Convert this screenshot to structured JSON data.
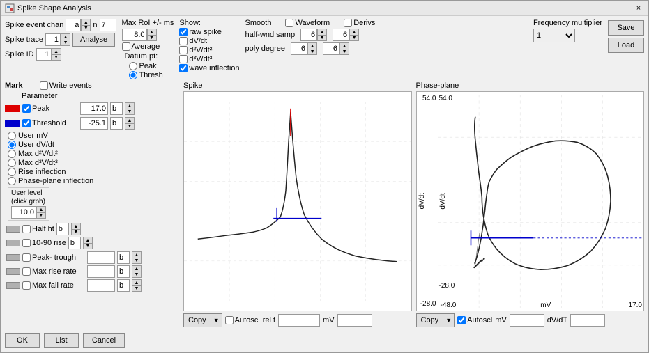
{
  "window": {
    "title": "Spike Shape Analysis",
    "close_label": "×"
  },
  "top": {
    "spike_event_label": "Spike event chan",
    "spike_event_val": "a",
    "n_label": "n",
    "n_val": "7",
    "max_roi_label": "Max RoI +/- ms",
    "max_roi_val": "8.0",
    "show_label": "Show:",
    "raw_spike_label": "raw spike",
    "dv_dt_label": "dV/dt",
    "d2v_dt2_label": "d²V/dt²",
    "d3v_dt3_label": "d³V/dt³",
    "wave_inflection_label": "wave inflection",
    "average_label": "Average",
    "datum_label": "Datum pt:",
    "peak_label": "Peak",
    "thresh_label": "Thresh",
    "smooth_label": "Smooth",
    "waveform_label": "Waveform",
    "derivs_label": "Derivs",
    "half_wnd_samp_label": "half-wnd samp",
    "poly_degree_label": "poly degree",
    "smooth_w1": "6",
    "smooth_w2": "6",
    "smooth_p1": "6",
    "smooth_p2": "6",
    "freq_mult_label": "Frequency multiplier",
    "freq_mult_val": "1",
    "save_label": "Save",
    "load_label": "Load"
  },
  "spike_trace": {
    "label": "Spike trace",
    "val": "1"
  },
  "spike_id": {
    "label": "Spike ID",
    "val": "1"
  },
  "analyse_label": "Analyse",
  "mark": {
    "label": "Mark",
    "write_events_label": "Write events",
    "parameter_label": "Parameter",
    "peak_label": "Peak",
    "peak_val": "17.0",
    "threshold_label": "Threshold",
    "threshold_val": "-25.1",
    "b_label": "b",
    "user_mv_label": "User mV",
    "user_dv_dt_label": "User dV/dt",
    "max_d2v_label": "Max d²V/dt²",
    "max_d3v_label": "Max d³V/dt³",
    "rise_inflection_label": "Rise inflection",
    "phase_plane_label": "Phase-plane inflection",
    "user_level_label": "User level\n(click grph)",
    "user_level_val": "10.0",
    "half_ht_label": "Half ht",
    "ten_90_rise_label": "10-90 rise",
    "peak_trough_label": "Peak- trough",
    "max_rise_rate_label": "Max rise rate",
    "max_fall_rate_label": "Max fall rate"
  },
  "spike_chart": {
    "title": "Spike"
  },
  "phase_plane_chart": {
    "title": "Phase-plane",
    "y_label": "dV/dt",
    "x_label": "mV",
    "x_left": "-48.0",
    "x_right": "17.0",
    "y_top": "54.0",
    "y_bottom": "-28.0"
  },
  "bottom_left": {
    "copy_label": "Copy",
    "autoscl_label": "Autoscl",
    "rel_t_label": "rel t",
    "mv_label": "mV"
  },
  "bottom_right": {
    "copy_label": "Copy",
    "autoscl_label": "Autoscl",
    "mv_label": "mV",
    "dv_dt_label": "dV/dT"
  },
  "footer": {
    "ok_label": "OK",
    "list_label": "List",
    "cancel_label": "Cancel"
  }
}
